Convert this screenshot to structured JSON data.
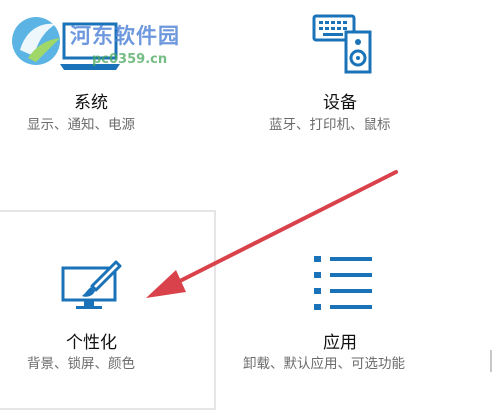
{
  "watermark": {
    "title": "河东软件园",
    "url": "pc0359.cn"
  },
  "tiles": {
    "system": {
      "title": "系统",
      "subtitle": "显示、通知、电源"
    },
    "devices": {
      "title": "设备",
      "subtitle": "蓝牙、打印机、鼠标"
    },
    "personalization": {
      "title": "个性化",
      "subtitle": "背景、锁屏、颜色"
    },
    "apps": {
      "title": "应用",
      "subtitle": "卸载、默认应用、可选功能"
    }
  },
  "colors": {
    "accent": "#1a73b8",
    "arrow": "#d9424a",
    "hover_border": "#e5e5e5"
  },
  "icons": {
    "system": "laptop-icon",
    "devices": "keyboard-speaker-icon",
    "personalization": "monitor-brush-icon",
    "apps": "list-icon"
  }
}
